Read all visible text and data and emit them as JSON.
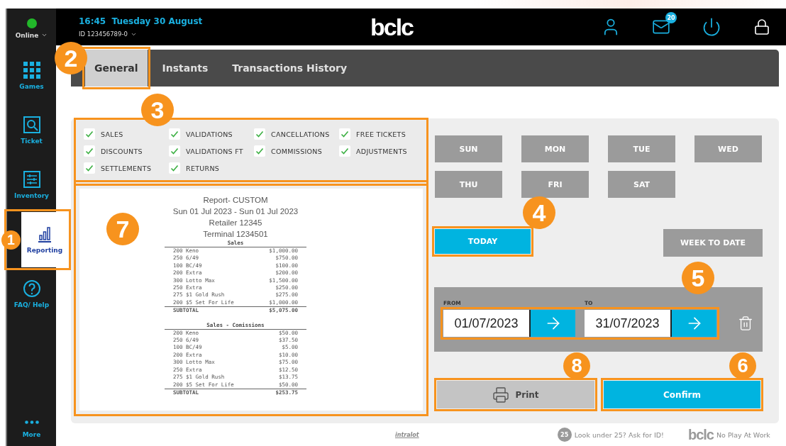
{
  "status": {
    "label": "Online",
    "online": true
  },
  "sidebar": {
    "items": [
      {
        "label": "Games",
        "kind": "grid",
        "selected": false
      },
      {
        "label": "Ticket",
        "kind": "ticket",
        "selected": false
      },
      {
        "label": "Inventory",
        "kind": "inventory",
        "selected": false
      },
      {
        "label": "Reporting",
        "kind": "chart",
        "selected": true,
        "callout": "1"
      },
      {
        "label": "FAQ/ Help",
        "kind": "help",
        "selected": false
      }
    ],
    "more": "More"
  },
  "header": {
    "datetime": "16:45  Tuesday 30 August",
    "terminal_id": "ID 123456789-0",
    "logo": "bclc",
    "messages_badge": "20"
  },
  "tabs": [
    {
      "label": "General",
      "selected": true,
      "callout": "2"
    },
    {
      "label": "Instants",
      "selected": false
    },
    {
      "label": "Transactions History",
      "selected": false
    }
  ],
  "filter_panel": {
    "callout": "3",
    "items": [
      {
        "label": "SALES",
        "checked": true
      },
      {
        "label": "VALIDATIONS",
        "checked": true
      },
      {
        "label": "CANCELLATIONS",
        "checked": true
      },
      {
        "label": "FREE TICKETS",
        "checked": true
      },
      {
        "label": "DISCOUNTS",
        "checked": true
      },
      {
        "label": "VALIDATIONS FT",
        "checked": true
      },
      {
        "label": "COMMISSIONS",
        "checked": true
      },
      {
        "label": "ADJUSTMENTS",
        "checked": true
      },
      {
        "label": "SETTLEMENTS",
        "checked": true
      },
      {
        "label": "RETURNS",
        "checked": true
      }
    ]
  },
  "report": {
    "callout": "7",
    "header_lines": [
      "Report- CUSTOM",
      "Sun 01 Jul 2023 - Sun 01 Jul 2023",
      "Retailer 12345",
      "Terminal 1234501"
    ],
    "sections": [
      {
        "title": "Sales",
        "rows": [
          {
            "item": "200 Keno",
            "amount": "$1,000.00"
          },
          {
            "item": "250 6/49",
            "amount": "$750.00"
          },
          {
            "item": "100 BC/49",
            "amount": "$100.00"
          },
          {
            "item": "200 Extra",
            "amount": "$200.00"
          },
          {
            "item": "300 Lotto Max",
            "amount": "$1,500.00"
          },
          {
            "item": "250 Extra",
            "amount": "$250.00"
          },
          {
            "item": "275 $1 Gold Rush",
            "amount": "$275.00"
          },
          {
            "item": "200 $5 Set For Life",
            "amount": "$1,000.00"
          }
        ],
        "subtotal_label": "SUBTOTAL",
        "subtotal": "$5,075.00"
      },
      {
        "title": "Sales - Comissions",
        "rows": [
          {
            "item": "200 Keno",
            "amount": "$50.00"
          },
          {
            "item": "250 6/49",
            "amount": "$37.50"
          },
          {
            "item": "100 BC/49",
            "amount": "$5.00"
          },
          {
            "item": "200 Extra",
            "amount": "$10.00"
          },
          {
            "item": "300 Lotto Max",
            "amount": "$75.00"
          },
          {
            "item": "250 Extra",
            "amount": "$12.50"
          },
          {
            "item": "275 $1 Gold Rush",
            "amount": "$13.75"
          },
          {
            "item": "200 $5 Set For Life",
            "amount": "$50.00"
          }
        ],
        "subtotal_label": "SUBTOTAL",
        "subtotal": "$253.75"
      }
    ]
  },
  "days": [
    {
      "label": "SUN",
      "selected": false
    },
    {
      "label": "MON",
      "selected": false
    },
    {
      "label": "TUE",
      "selected": false
    },
    {
      "label": "WED",
      "selected": false
    },
    {
      "label": "THU",
      "selected": false
    },
    {
      "label": "FRI",
      "selected": false
    },
    {
      "label": "SAT",
      "selected": false
    }
  ],
  "quick_ranges": [
    {
      "label": "TODAY",
      "selected": true,
      "callout": "4"
    },
    {
      "label": "WEEK TO DATE",
      "selected": false
    }
  ],
  "date_range": {
    "callout": "5",
    "from_label": "FROM",
    "from": "01/07/2023",
    "to_label": "TO",
    "to": "31/07/2023"
  },
  "actions": {
    "print": {
      "label": "Print",
      "callout": "8"
    },
    "confirm": {
      "label": "Confirm",
      "callout": "6"
    }
  },
  "footer": {
    "vendor": "intralot",
    "age_badge": "25",
    "age_notice": "Look under 25? Ask for ID!",
    "brand": "bclc",
    "slogan": "No Play At Work"
  }
}
